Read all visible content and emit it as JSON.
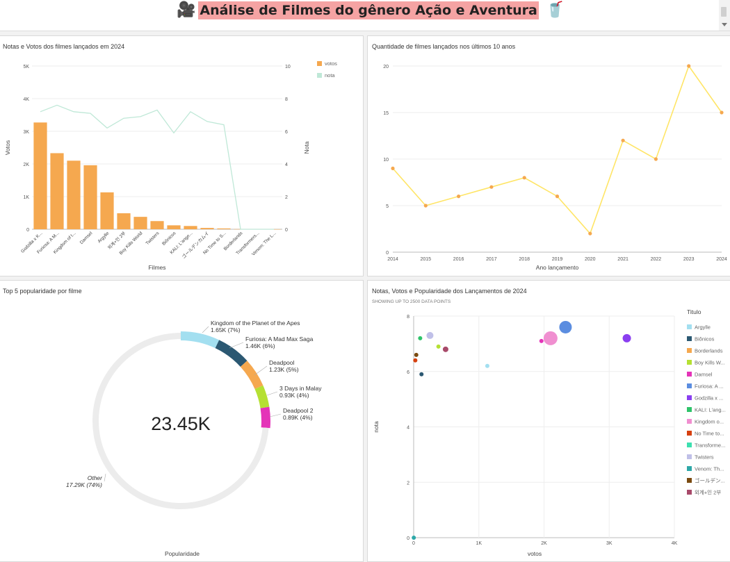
{
  "header": {
    "title": "Análise de Filmes do gênero Ação e Aventura",
    "icon_left": "🎥",
    "icon_right": "🥤",
    "icon_left_name": "movie-camera-icon",
    "icon_right_name": "popcorn-icon"
  },
  "panels": {
    "combo": {
      "title": "Notas e Votos dos filmes lançados em 2024"
    },
    "line": {
      "title": "Quantidade de filmes lançados nos últimos 10 anos"
    },
    "donut": {
      "title": "Top 5 popularidade por filme",
      "center_value": "23.45K",
      "axis_label": "Popularidade"
    },
    "scatter": {
      "title": "Notas, Votos e Popularidade dos Lançamentos de  2024",
      "subtitle": "SHOWING UP TO 2500 DATA POINTS",
      "legend_title": "Titulo"
    }
  },
  "chart_data": [
    {
      "type": "bar",
      "title": "Notas e Votos dos filmes lançados em 2024",
      "xlabel": "Filmes",
      "ylabel": "Votos",
      "y2label": "Nota",
      "categories": [
        "Godzilla x K...",
        "Furiosa: A M...",
        "Kingdom of t...",
        "Damsel",
        "Argylle",
        "외계+인 2부",
        "Boy Kills World",
        "Twisters",
        "Biônicos",
        "KALI: L'ange...",
        "ゴールデンカムイ",
        "No Time to S...",
        "Borderlands",
        "Transformers...",
        "Venom: The L..."
      ],
      "ylim": [
        0,
        5000
      ],
      "y2lim": [
        0,
        10
      ],
      "yticks": [
        "0",
        "1K",
        "2K",
        "3K",
        "4K",
        "5K"
      ],
      "y2ticks": [
        "0",
        "2",
        "4",
        "6",
        "8",
        "10"
      ],
      "series": [
        {
          "name": "votos",
          "kind": "bar",
          "color": "#f5a84f",
          "values": [
            3270,
            2330,
            2100,
            1960,
            1130,
            490,
            380,
            250,
            120,
            100,
            40,
            25,
            5,
            3,
            2
          ]
        },
        {
          "name": "nota",
          "kind": "line",
          "color": "#bfe8d7",
          "values": [
            7.2,
            7.6,
            7.2,
            7.1,
            6.2,
            6.8,
            6.9,
            7.3,
            5.9,
            7.2,
            6.6,
            6.4,
            0,
            0,
            0
          ]
        }
      ],
      "legend": "top-right"
    },
    {
      "type": "line",
      "title": "Quantidade de filmes lançados nos últimos 10 anos",
      "xlabel": "Ano lançamento",
      "ylabel": "",
      "x": [
        "2014",
        "2015",
        "2016",
        "2017",
        "2018",
        "2019",
        "2020",
        "2021",
        "2022",
        "2023",
        "2024"
      ],
      "values": [
        9,
        5,
        6,
        7,
        8,
        6,
        2,
        12,
        10,
        20,
        15
      ],
      "ylim": [
        0,
        20
      ],
      "yticks": [
        "0",
        "5",
        "10",
        "15",
        "20"
      ],
      "line_color": "#ffe566",
      "point_color": "#f5a84f"
    },
    {
      "type": "pie",
      "title": "Top 5 popularidade por filme",
      "total": "23.45K",
      "slices": [
        {
          "label": "Kingdom of the Planet of the Apes",
          "value_text": "1.65K (7%)",
          "value": 1650,
          "color": "#a3dff0"
        },
        {
          "label": "Furiosa: A Mad Max Saga",
          "value_text": "1.46K (6%)",
          "value": 1460,
          "color": "#2b5872"
        },
        {
          "label": "Deadpool",
          "value_text": "1.23K (5%)",
          "value": 1230,
          "color": "#f5a84f"
        },
        {
          "label": "3 Days in Malay",
          "value_text": "0.93K (4%)",
          "value": 930,
          "color": "#b5e033"
        },
        {
          "label": "Deadpool 2",
          "value_text": "0.89K (4%)",
          "value": 890,
          "color": "#e433b8"
        },
        {
          "label": "Other",
          "value_text": "17.29K (74%)",
          "value": 17290,
          "color": "#ececec"
        }
      ]
    },
    {
      "type": "scatter",
      "title": "Notas, Votos e Popularidade dos Lançamentos de  2024",
      "xlabel": "votos",
      "ylabel": "nota",
      "xlim": [
        0,
        4000
      ],
      "ylim": [
        0,
        8
      ],
      "xticks": [
        "0",
        "1K",
        "2K",
        "3K",
        "4K"
      ],
      "yticks": [
        "0",
        "2",
        "4",
        "6",
        "8"
      ],
      "points": [
        {
          "name": "Argylle",
          "x": 1130,
          "y": 6.2,
          "size": 3,
          "color": "#a3dff0"
        },
        {
          "name": "Biônicos",
          "x": 120,
          "y": 5.9,
          "size": 3,
          "color": "#2b5872"
        },
        {
          "name": "Borderlands",
          "x": 5,
          "y": 0,
          "size": 2,
          "color": "#f5a84f"
        },
        {
          "name": "Boy Kills World",
          "x": 380,
          "y": 6.9,
          "size": 3,
          "color": "#b5e033"
        },
        {
          "name": "Damsel",
          "x": 1960,
          "y": 7.1,
          "size": 3,
          "color": "#e433b8"
        },
        {
          "name": "Furiosa: A Mad Max Saga",
          "x": 2330,
          "y": 7.6,
          "size": 9,
          "color": "#5b8de0"
        },
        {
          "name": "Godzilla x Kong",
          "x": 3270,
          "y": 7.2,
          "size": 6,
          "color": "#8a3ff0"
        },
        {
          "name": "KALI: L'ange",
          "x": 100,
          "y": 7.2,
          "size": 3,
          "color": "#2ec46a"
        },
        {
          "name": "Kingdom of the Planet of the Apes",
          "x": 2100,
          "y": 7.2,
          "size": 10,
          "color": "#f08fd0"
        },
        {
          "name": "No Time to Spy",
          "x": 25,
          "y": 6.4,
          "size": 3,
          "color": "#d6400f"
        },
        {
          "name": "Transformers One",
          "x": 3,
          "y": 0,
          "size": 2,
          "color": "#3de0b0"
        },
        {
          "name": "Twisters",
          "x": 250,
          "y": 7.3,
          "size": 5,
          "color": "#c0c0e8"
        },
        {
          "name": "Venom: The Last Dance",
          "x": 2,
          "y": 0,
          "size": 3,
          "color": "#2ea8a8"
        },
        {
          "name": "ゴールデンカムイ",
          "x": 40,
          "y": 6.6,
          "size": 3,
          "color": "#7a4a10"
        },
        {
          "name": "외계+인 2부",
          "x": 490,
          "y": 6.8,
          "size": 4,
          "color": "#a84a6a"
        }
      ],
      "legend_items": [
        {
          "label": "Argylle",
          "color": "#a3dff0"
        },
        {
          "label": "Biônicos",
          "color": "#2b5872"
        },
        {
          "label": "Borderlands",
          "color": "#f5a84f"
        },
        {
          "label": "Boy Kills W...",
          "color": "#b5e033"
        },
        {
          "label": "Damsel",
          "color": "#e433b8"
        },
        {
          "label": "Furiosa: A ...",
          "color": "#5b8de0"
        },
        {
          "label": "Godzilla x ...",
          "color": "#8a3ff0"
        },
        {
          "label": "KALI: L'ang...",
          "color": "#2ec46a"
        },
        {
          "label": "Kingdom o...",
          "color": "#f08fd0"
        },
        {
          "label": "No Time to...",
          "color": "#d6400f"
        },
        {
          "label": "Transforme...",
          "color": "#3de0b0"
        },
        {
          "label": "Twisters",
          "color": "#c0c0e8"
        },
        {
          "label": "Venom: Th...",
          "color": "#2ea8a8"
        },
        {
          "label": "ゴールデン...",
          "color": "#7a4a10"
        },
        {
          "label": "외계+인 2부",
          "color": "#a84a6a"
        }
      ]
    }
  ]
}
